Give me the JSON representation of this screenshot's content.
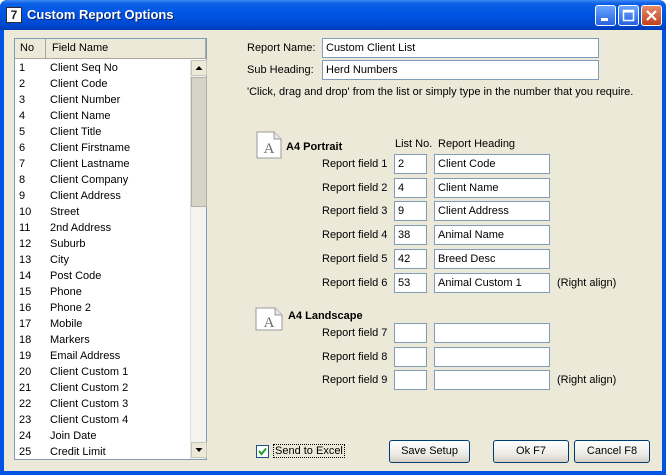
{
  "window": {
    "title": "Custom Report Options",
    "app_icon_glyph": "7"
  },
  "list": {
    "headers": {
      "no": "No",
      "field": "Field Name"
    },
    "rows": [
      {
        "no": "1",
        "name": "Client Seq No"
      },
      {
        "no": "2",
        "name": "Client Code"
      },
      {
        "no": "3",
        "name": "Client Number"
      },
      {
        "no": "4",
        "name": "Client Name"
      },
      {
        "no": "5",
        "name": "Client Title"
      },
      {
        "no": "6",
        "name": "Client Firstname"
      },
      {
        "no": "7",
        "name": "Client Lastname"
      },
      {
        "no": "8",
        "name": "Client Company"
      },
      {
        "no": "9",
        "name": "Client Address"
      },
      {
        "no": "10",
        "name": "Street"
      },
      {
        "no": "11",
        "name": "2nd Address"
      },
      {
        "no": "12",
        "name": "Suburb"
      },
      {
        "no": "13",
        "name": "City"
      },
      {
        "no": "14",
        "name": "Post Code"
      },
      {
        "no": "15",
        "name": "Phone"
      },
      {
        "no": "16",
        "name": "Phone 2"
      },
      {
        "no": "17",
        "name": "Mobile"
      },
      {
        "no": "18",
        "name": "Markers"
      },
      {
        "no": "19",
        "name": "Email Address"
      },
      {
        "no": "20",
        "name": "Client Custom 1"
      },
      {
        "no": "21",
        "name": "Client Custom 2"
      },
      {
        "no": "22",
        "name": "Client Custom 3"
      },
      {
        "no": "23",
        "name": "Client Custom 4"
      },
      {
        "no": "24",
        "name": "Join Date"
      },
      {
        "no": "25",
        "name": "Credit Limit"
      }
    ]
  },
  "report": {
    "name_label": "Report Name:",
    "name_value": "Custom Client List",
    "subheading_label": "Sub Heading:",
    "subheading_value": "Herd Numbers",
    "instruction": "'Click, drag and drop' from the list or simply type in the number that you require."
  },
  "portrait": {
    "title": "A4 Portrait",
    "col_list_no": "List No.",
    "col_heading": "Report Heading",
    "fields": [
      {
        "label": "Report field 1",
        "no": "2",
        "heading": "Client Code"
      },
      {
        "label": "Report field 2",
        "no": "4",
        "heading": "Client Name"
      },
      {
        "label": "Report field 3",
        "no": "9",
        "heading": "Client Address"
      },
      {
        "label": "Report field 4",
        "no": "38",
        "heading": "Animal Name"
      },
      {
        "label": "Report field 5",
        "no": "42",
        "heading": "Breed Desc"
      },
      {
        "label": "Report field 6",
        "no": "53",
        "heading": "Animal Custom 1"
      }
    ],
    "right_align": "(Right align)"
  },
  "landscape": {
    "title": "A4 Landscape",
    "fields": [
      {
        "label": "Report field 7",
        "no": "",
        "heading": ""
      },
      {
        "label": "Report field 8",
        "no": "",
        "heading": ""
      },
      {
        "label": "Report field 9",
        "no": "",
        "heading": ""
      }
    ],
    "right_align": "(Right align)"
  },
  "doc_icon_letter": "A",
  "footer": {
    "send_to_excel": "Send to Excel",
    "send_to_excel_checked": true,
    "save_setup": "Save Setup",
    "ok": "Ok F7",
    "cancel": "Cancel F8"
  },
  "colors": {
    "titlebar": "#0054e3",
    "face": "#ece9d8",
    "border": "#7f9db9"
  }
}
